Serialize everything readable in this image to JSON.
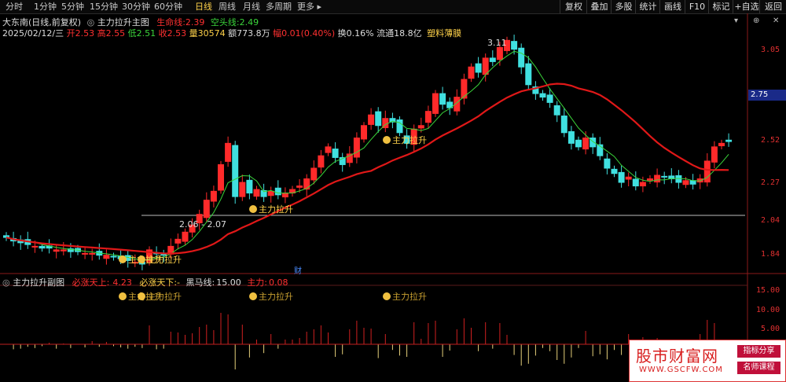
{
  "toolbar": {
    "periods": [
      "分时",
      "1分钟",
      "5分钟",
      "15分钟",
      "30分钟",
      "60分钟",
      "日线",
      "周线",
      "月线",
      "多周期",
      "更多"
    ],
    "active_period": "日线",
    "right_buttons": [
      "复权",
      "叠加",
      "多股",
      "统计",
      "画线",
      "F10",
      "标记",
      "+自选",
      "返回"
    ]
  },
  "header": {
    "stock_name": "大东南(日线,前复权)",
    "indicator_name": "主力拉升主图",
    "life_line_label": "生命线:",
    "life_line_value": "2.39",
    "short_line_label": "空头线:",
    "short_line_value": "2.49"
  },
  "quote": {
    "date": "2025/02/12/三",
    "open_label": "开",
    "open": "2.53",
    "high_label": "高",
    "high": "2.55",
    "low_label": "低",
    "low": "2.51",
    "close_label": "收",
    "close": "2.53",
    "volume_label": "量",
    "volume": "30574",
    "amount_label": "额",
    "amount": "773.8万",
    "change_label": "幅",
    "change": "0.01(0.40%)",
    "turnover_label": "换",
    "turnover": "0.16%",
    "float_label": "流通",
    "float_cap": "18.8亿",
    "sector": "塑料薄膜"
  },
  "price_axis": {
    "ticks": [
      "3.05",
      "2.75",
      "2.52",
      "2.27",
      "2.04",
      "1.84"
    ],
    "current_price_box": "2.75",
    "peak_label": "3.11",
    "range_label": "2.06 - 2.07"
  },
  "signals": {
    "label": "主力拉升",
    "marker_text": "财"
  },
  "sub_header": {
    "name": "主力拉升副图",
    "must_rise_label": "必涨天上:",
    "must_rise_value": "4.23",
    "must_rise_below_label": "必涨天下:",
    "must_rise_below_value": "-",
    "black_horse_label": "黑马线:",
    "black_horse_value": "15.00",
    "main_force_label": "主力:",
    "main_force_value": "0.08"
  },
  "sub_axis": {
    "ticks": [
      "15.00",
      "10.00",
      "5.00"
    ]
  },
  "watermark": {
    "title": "股市财富网",
    "url": "WWW.GSCFW.COM",
    "badge1": "指标分享",
    "badge2": "名师课程"
  },
  "colors": {
    "up": "#ff2a2a",
    "down": "#40e0e0",
    "ma_short": "#ffffff",
    "ma_long": "#e01818",
    "green_line": "#3ad43a",
    "yellow": "#ffd24a"
  },
  "chart_data": {
    "type": "candlestick",
    "price_range": [
      1.8,
      3.15
    ],
    "series": [
      {
        "name": "生命线",
        "values": []
      },
      {
        "name": "空头线",
        "values": []
      }
    ],
    "candles_close_approx": [
      1.99,
      1.97,
      1.96,
      1.95,
      1.94,
      1.93,
      1.93,
      1.92,
      1.92,
      1.91,
      1.91,
      1.9,
      1.9,
      1.89,
      1.89,
      1.88,
      1.87,
      1.86,
      1.85,
      1.84,
      1.92,
      1.9,
      1.89,
      1.94,
      1.98,
      2.02,
      2.06,
      2.12,
      2.2,
      2.25,
      2.4,
      2.52,
      2.22,
      2.3,
      2.24,
      2.26,
      2.22,
      2.25,
      2.23,
      2.24,
      2.26,
      2.28,
      2.32,
      2.38,
      2.45,
      2.5,
      2.44,
      2.4,
      2.46,
      2.55,
      2.62,
      2.68,
      2.62,
      2.66,
      2.64,
      2.58,
      2.52,
      2.6,
      2.62,
      2.7,
      2.8,
      2.74,
      2.72,
      2.78,
      2.88,
      2.95,
      2.92,
      3.0,
      2.98,
      3.06,
      3.1,
      3.05,
      2.95,
      2.85,
      2.8,
      2.78,
      2.75,
      2.68,
      2.58,
      2.52,
      2.5,
      2.55,
      2.5,
      2.45,
      2.38,
      2.35,
      2.3,
      2.33,
      2.28,
      2.3,
      2.32,
      2.34,
      2.33,
      2.32,
      2.3,
      2.31,
      2.29,
      2.32,
      2.42,
      2.5,
      2.52,
      2.53
    ]
  }
}
